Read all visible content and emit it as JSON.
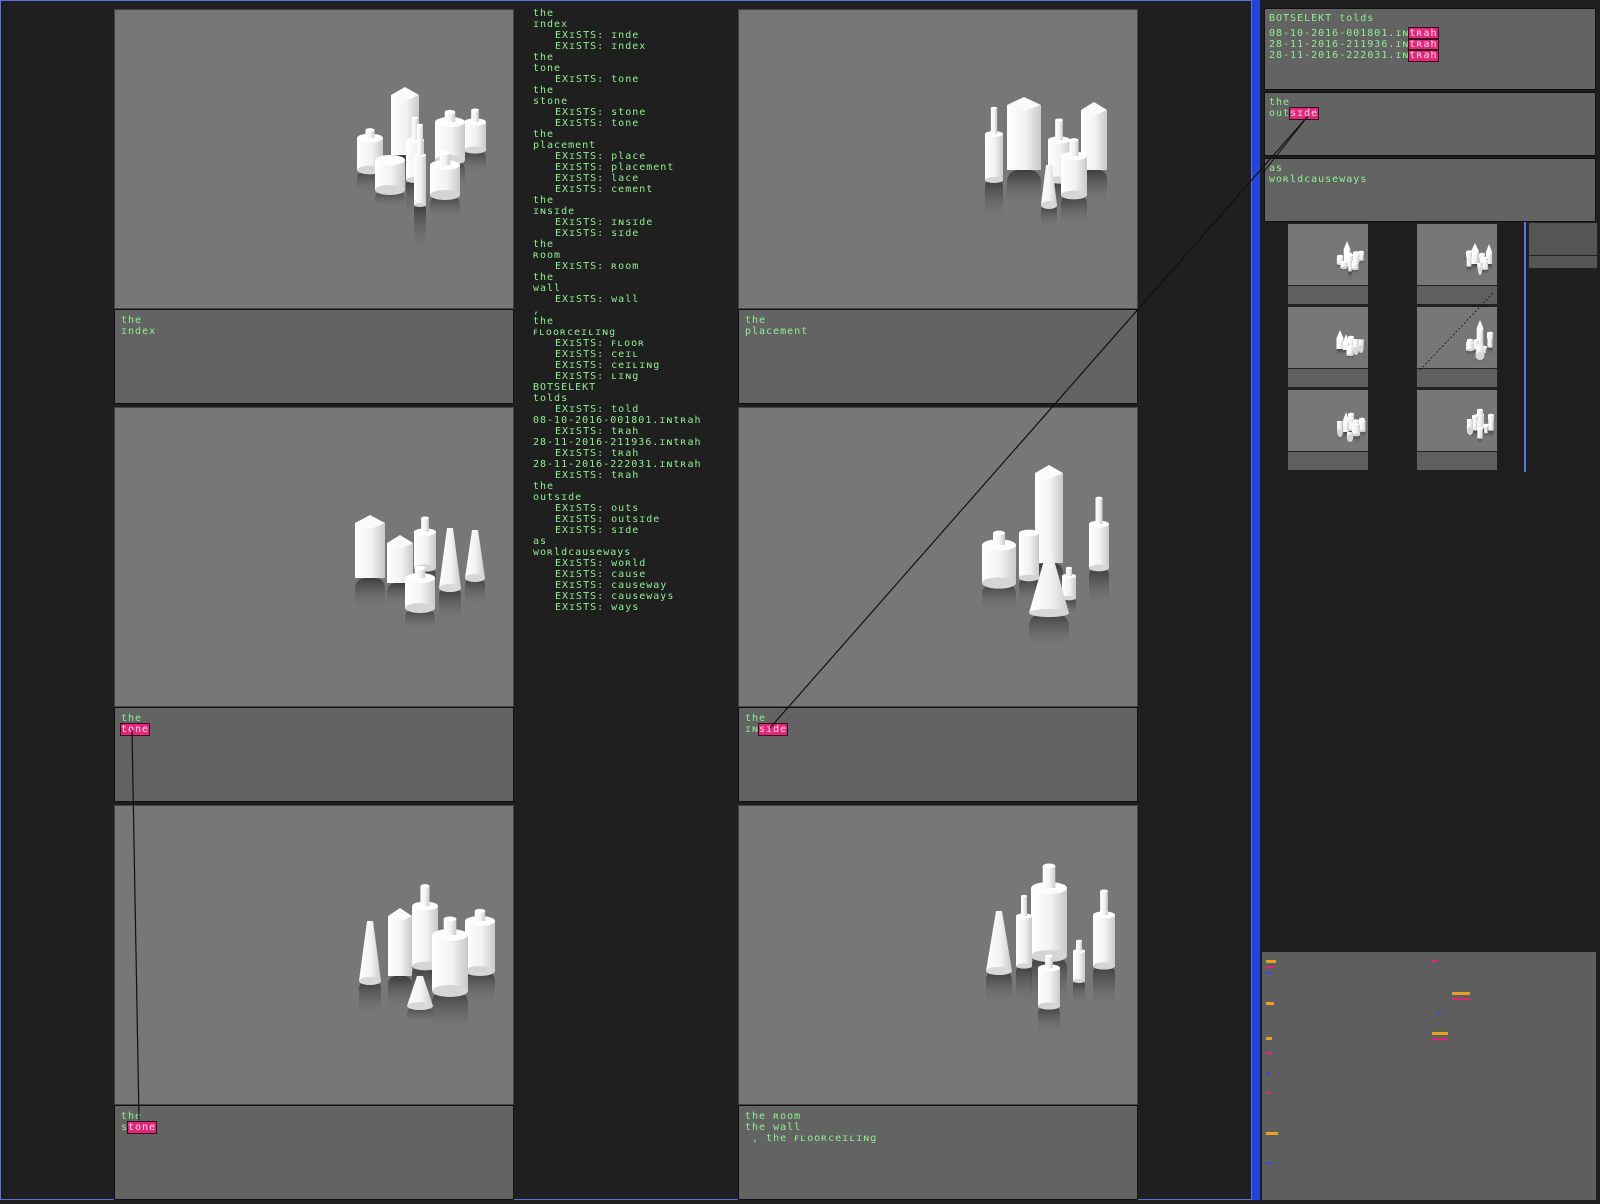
{
  "panels": [
    {
      "name": "index",
      "lines": [
        [
          "the"
        ],
        [
          "ɪndex"
        ]
      ]
    },
    {
      "name": "placement",
      "lines": [
        [
          "the"
        ],
        [
          "placement"
        ]
      ]
    },
    {
      "name": "tone",
      "lines": [
        [
          "the"
        ],
        [
          {
            "hl": "tone"
          }
        ]
      ]
    },
    {
      "name": "inside",
      "lines": [
        [
          "the"
        ],
        [
          "ɪɴ",
          {
            "hl": "sɪde"
          }
        ]
      ]
    },
    {
      "name": "stone",
      "lines": [
        [
          "the"
        ],
        [
          "s",
          {
            "hl": "tone"
          }
        ]
      ]
    },
    {
      "name": "room",
      "lines": [
        [
          "the ʀoom"
        ],
        [
          "the wall"
        ],
        [
          ""
        ],
        [
          " , the ꜰʟooʀceɪʟɪɴg"
        ]
      ]
    }
  ],
  "listing": [
    {
      "t": "the"
    },
    {
      "t": "ɪndex"
    },
    {
      "t": "EXɪSTS: ɪnde",
      "i": 1
    },
    {
      "t": "EXɪSTS: ɪndex",
      "i": 1
    },
    {
      "t": "the"
    },
    {
      "t": "tone"
    },
    {
      "t": "EXɪSTS: tone",
      "i": 1
    },
    {
      "t": "the"
    },
    {
      "t": "stone"
    },
    {
      "t": "EXɪSTS: stone",
      "i": 1
    },
    {
      "t": "EXɪSTS: tone",
      "i": 1
    },
    {
      "t": "the"
    },
    {
      "t": "placement"
    },
    {
      "t": "EXɪSTS: place",
      "i": 1
    },
    {
      "t": "EXɪSTS: placement",
      "i": 1
    },
    {
      "t": "EXɪSTS: lace",
      "i": 1
    },
    {
      "t": "EXɪSTS: cement",
      "i": 1
    },
    {
      "t": "the"
    },
    {
      "t": "ɪɴsɪde"
    },
    {
      "t": "EXɪSTS: ɪɴsɪde",
      "i": 1
    },
    {
      "t": "EXɪSTS: sɪde",
      "i": 1
    },
    {
      "t": "the"
    },
    {
      "t": "ʀoom"
    },
    {
      "t": "EXɪSTS: ʀoom",
      "i": 1
    },
    {
      "t": "the"
    },
    {
      "t": "wall"
    },
    {
      "t": "EXɪSTS: wall",
      "i": 1
    },
    {
      "t": ","
    },
    {
      "t": "the"
    },
    {
      "t": "ꜰʟooʀceɪʟɪɴg"
    },
    {
      "t": "EXɪSTS: ꜰʟooʀ",
      "i": 1
    },
    {
      "t": "EXɪSTS: ceɪʟ",
      "i": 1
    },
    {
      "t": "EXɪSTS: ceɪʟɪɴg",
      "i": 1
    },
    {
      "t": "EXɪSTS: ʟɪɴg",
      "i": 1
    },
    {
      "t": "BOTSELEKT"
    },
    {
      "t": "tolds"
    },
    {
      "t": "EXɪSTS: told",
      "i": 1
    },
    {
      "t": "08-10-2016-001801.ɪɴtʀah"
    },
    {
      "t": "EXɪSTS: tʀah",
      "i": 1
    },
    {
      "t": "28-11-2016-211936.ɪɴtʀah"
    },
    {
      "t": "EXɪSTS: tʀah",
      "i": 1
    },
    {
      "t": "28-11-2016-222031.ɪɴtʀah"
    },
    {
      "t": "EXɪSTS: tʀah",
      "i": 1
    },
    {
      "t": "the"
    },
    {
      "t": "outsɪde"
    },
    {
      "t": "EXɪSTS: outs",
      "i": 1
    },
    {
      "t": "EXɪSTS: outsɪde",
      "i": 1
    },
    {
      "t": "EXɪSTS: sɪde",
      "i": 1
    },
    {
      "t": "as"
    },
    {
      "t": "woʀldcauseways"
    },
    {
      "t": "EXɪSTS: woʀld",
      "i": 1
    },
    {
      "t": "EXɪSTS: cause",
      "i": 1
    },
    {
      "t": "EXɪSTS: causeway",
      "i": 1
    },
    {
      "t": "EXɪSTS: causeways",
      "i": 1
    },
    {
      "t": "EXɪSTS: ways",
      "i": 1
    }
  ],
  "right": {
    "header": "BOTSELEKT tolds",
    "files": [
      {
        "base": "08-10-2016-001801.ɪɴ",
        "hl": "tʀah"
      },
      {
        "base": "28-11-2016-211936.ɪɴ",
        "hl": "tʀah"
      },
      {
        "base": "28-11-2016-222031.ɪɴ",
        "hl": "tʀah"
      }
    ],
    "outside_line1": "the",
    "outside_base": "out",
    "outside_hl": "sɪde",
    "as_line": "as",
    "causeways": "woʀldcauseways"
  },
  "colors": {
    "text": "#8ff08f",
    "highlight": "#e0287a",
    "divider": "#2346d8",
    "scene": "#777777",
    "caption": "#636363"
  }
}
